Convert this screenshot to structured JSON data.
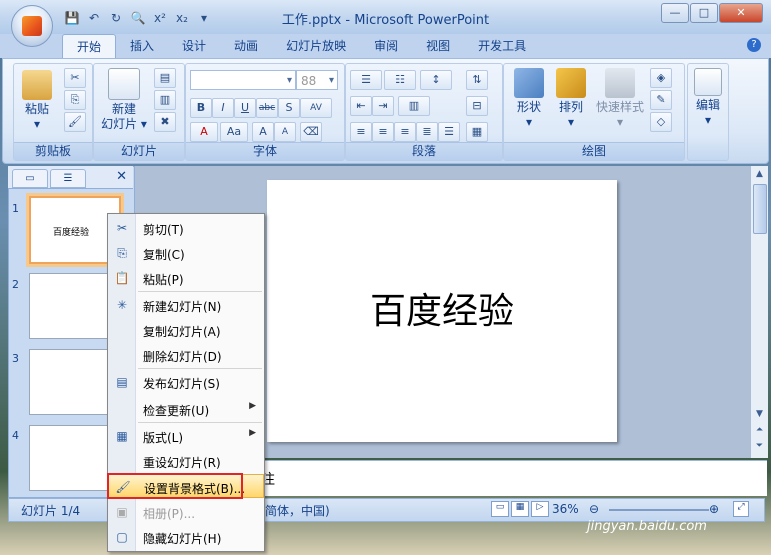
{
  "window": {
    "title": "工作.pptx - Microsoft PowerPoint",
    "minimize": "—",
    "maximize": "□",
    "close": "✕"
  },
  "qat": {
    "save": "💾",
    "undo": "↶",
    "redo": "↻",
    "preview": "🔍",
    "sup": "x²",
    "sub": "x₂",
    "more": "▾"
  },
  "tabs": [
    "开始",
    "插入",
    "设计",
    "动画",
    "幻灯片放映",
    "审阅",
    "视图",
    "开发工具"
  ],
  "ribbon": {
    "clipboard": {
      "label": "剪贴板",
      "paste": "粘贴"
    },
    "slides": {
      "label": "幻灯片",
      "new_slide_1": "新建",
      "new_slide_2": "幻灯片"
    },
    "font": {
      "label": "字体",
      "size": "88",
      "bold": "B",
      "italic": "I",
      "underline": "U",
      "strike": "abc",
      "shadow": "S",
      "spacing": "AV",
      "color": "A",
      "case": "Aa",
      "grow": "A",
      "shrink": "A"
    },
    "paragraph": {
      "label": "段落"
    },
    "drawing": {
      "label": "绘图",
      "shapes": "形状",
      "arrange": "排列",
      "quick_styles": "快速样式"
    },
    "editing": {
      "label": "编辑"
    }
  },
  "thumbnails": [
    {
      "num": "1",
      "text": "百度经验"
    },
    {
      "num": "2",
      "text": ""
    },
    {
      "num": "3",
      "text": ""
    },
    {
      "num": "4",
      "text": ""
    }
  ],
  "slide": {
    "title": "百度经验"
  },
  "notes": {
    "text": "注"
  },
  "status": {
    "slide": "幻灯片 1/4",
    "lang": "简体，中国)",
    "zoom": "36%"
  },
  "context_menu": [
    {
      "label": "剪切(T)",
      "icon": "✂"
    },
    {
      "label": "复制(C)",
      "icon": "⎘"
    },
    {
      "label": "粘贴(P)",
      "icon": "📋"
    },
    {
      "label": "新建幻灯片(N)",
      "icon": "✳"
    },
    {
      "label": "复制幻灯片(A)",
      "icon": ""
    },
    {
      "label": "删除幻灯片(D)",
      "icon": ""
    },
    {
      "label": "发布幻灯片(S)",
      "icon": "▤"
    },
    {
      "label": "检查更新(U)",
      "icon": "",
      "sub": "▶"
    },
    {
      "label": "版式(L)",
      "icon": "▦",
      "sub": "▶"
    },
    {
      "label": "重设幻灯片(R)",
      "icon": ""
    },
    {
      "label": "设置背景格式(B)...",
      "icon": "🖌"
    },
    {
      "label": "相册(P)...",
      "icon": "▣"
    },
    {
      "label": "隐藏幻灯片(H)",
      "icon": "▢"
    }
  ],
  "watermark": "jingyan.baidu.com"
}
